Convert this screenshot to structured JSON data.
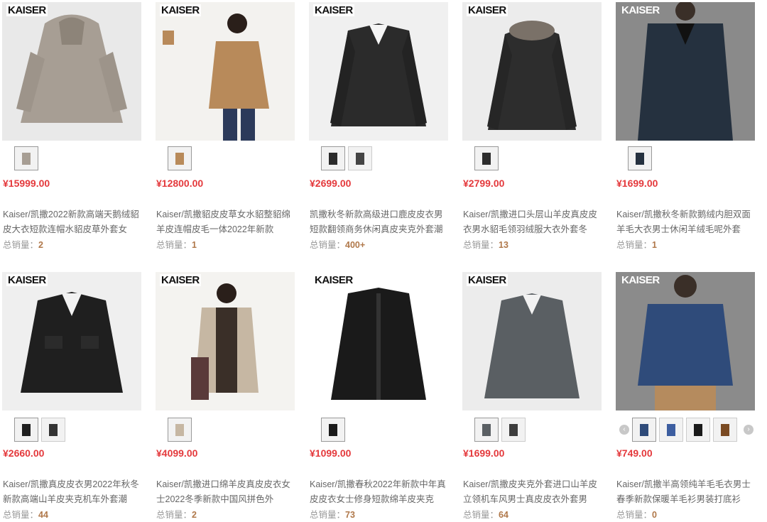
{
  "products": [
    {
      "brand": "KAISER",
      "price": "¥15999.00",
      "title": "Kaiser/凯撒2022新款高端天鹅绒貂皮大衣短款连帽水貂皮草外套女",
      "sales_label": "总销量：",
      "sales": "2"
    },
    {
      "brand": "KAISER",
      "price": "¥12800.00",
      "title": "Kaiser/凯撒貂皮皮草女水貂整貂绵羊皮连帽皮毛一体2022年新款",
      "sales_label": "总销量：",
      "sales": "1"
    },
    {
      "brand": "KAISER",
      "price": "¥2699.00",
      "title": "凯撒秋冬新款高级进口鹿皮皮衣男短款翻领商务休闲真皮夹克外套潮",
      "sales_label": "总销量：",
      "sales": "400+"
    },
    {
      "brand": "KAISER",
      "price": "¥2799.00",
      "title": "Kaiser/凯撒进口头层山羊皮真皮皮衣男水貂毛领羽绒服大衣外套冬",
      "sales_label": "总销量：",
      "sales": "13"
    },
    {
      "brand": "KAISER",
      "price": "¥1699.00",
      "title": "Kaiser/凯撒秋冬新款鹅绒内胆双面羊毛大衣男士休闲羊绒毛呢外套",
      "sales_label": "总销量：",
      "sales": "1"
    },
    {
      "brand": "KAISER",
      "price": "¥2660.00",
      "title": "Kaiser/凯撒真皮皮衣男2022年秋冬新款高端山羊皮夹克机车外套潮",
      "sales_label": "总销量：",
      "sales": "44"
    },
    {
      "brand": "KAISER",
      "price": "¥4099.00",
      "title": "Kaiser/凯撒进口绵羊皮真皮皮衣女士2022冬季新款中国风拼色外",
      "sales_label": "总销量：",
      "sales": "2"
    },
    {
      "brand": "KAISER",
      "price": "¥1099.00",
      "title": "Kaiser/凯撒春秋2022年新款中年真皮皮衣女士修身短款绵羊皮夹克",
      "sales_label": "总销量：",
      "sales": "73"
    },
    {
      "brand": "KAISER",
      "price": "¥1699.00",
      "title": "Kaiser/凯撒皮夹克外套进口山羊皮立领机车风男士真皮皮衣外套男",
      "sales_label": "总销量：",
      "sales": "64"
    },
    {
      "brand": "KAISER",
      "price": "¥749.00",
      "title": "Kaiser/凯撒半高领纯羊毛毛衣男士春季新款保暖羊毛衫男装打底衫",
      "sales_label": "总销量：",
      "sales": "0"
    }
  ],
  "colors": {
    "price": "#e4393c",
    "sales_value": "#b0784a",
    "title": "#666666"
  },
  "icons": {
    "prev": "‹",
    "next": "›"
  }
}
